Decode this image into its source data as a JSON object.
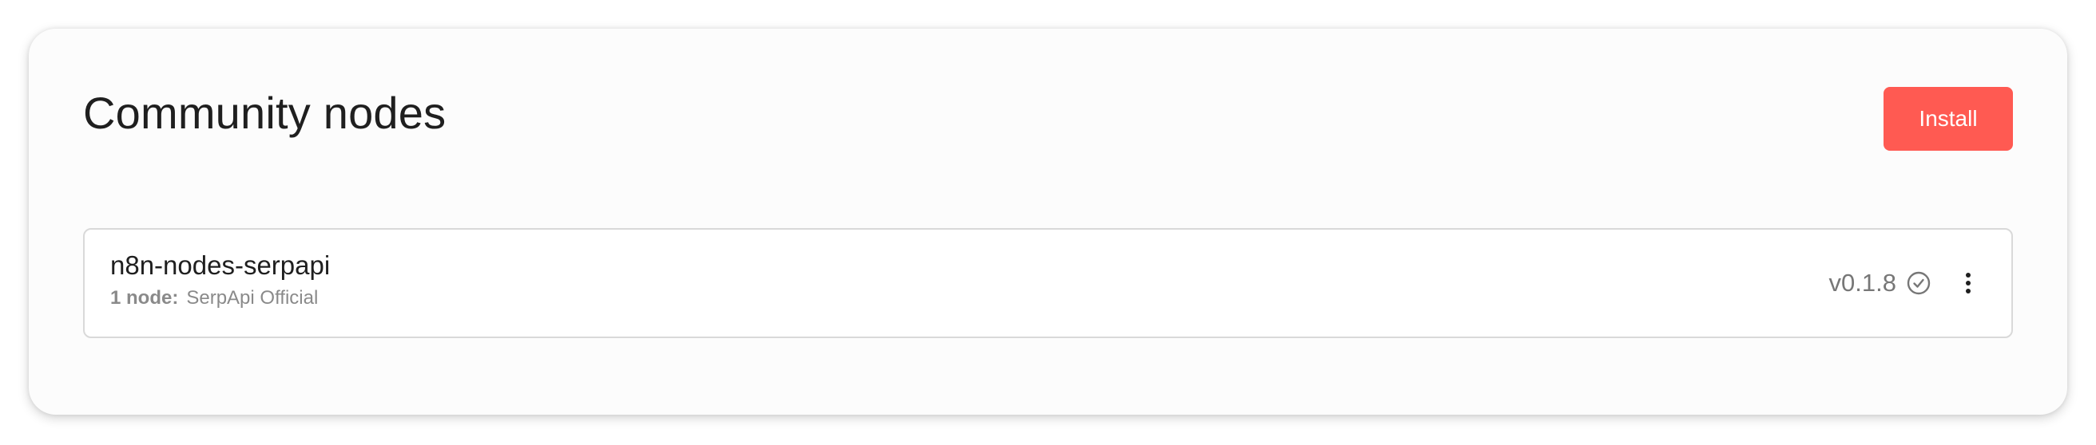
{
  "page": {
    "title": "Community nodes",
    "install_label": "Install"
  },
  "packages": [
    {
      "name": "n8n-nodes-serpapi",
      "node_count_label": "1 node:",
      "nodes": "SerpApi Official",
      "version": "v0.1.8",
      "status_icon": "check-circle-icon",
      "menu_icon": "vertical-dots-icon"
    }
  ],
  "colors": {
    "accent": "#ff5a52",
    "text": "#1f1f1f",
    "muted": "#8a8a8a"
  }
}
